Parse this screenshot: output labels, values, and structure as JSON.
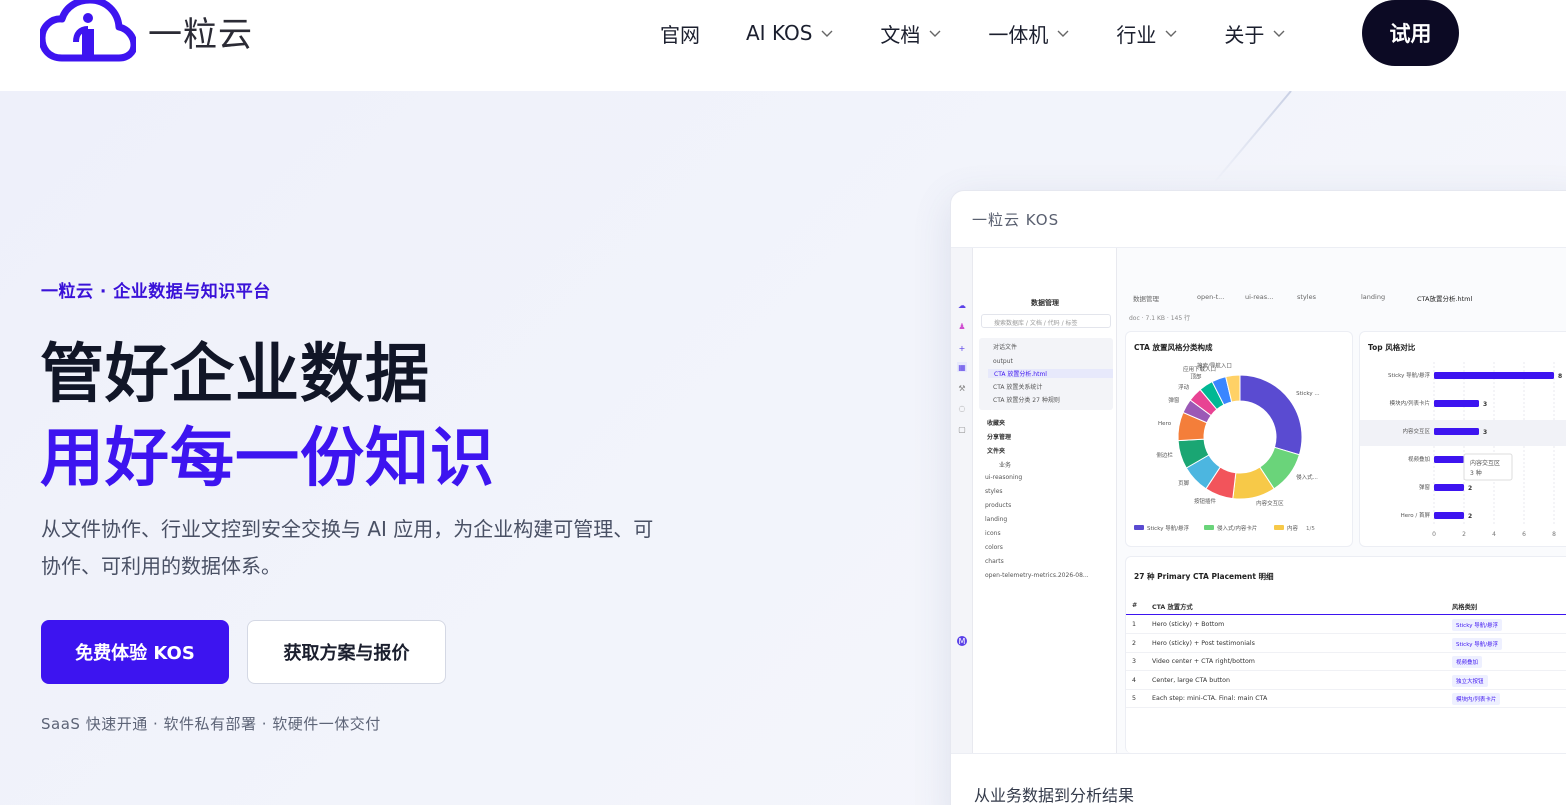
{
  "brand": {
    "name": "一粒云",
    "accent": "#3d14f0",
    "dark": "#0c0a24"
  },
  "nav": {
    "items": [
      {
        "label": "官网",
        "has_dropdown": false
      },
      {
        "label": "AI KOS",
        "has_dropdown": true
      },
      {
        "label": "文档",
        "has_dropdown": true
      },
      {
        "label": "一体机",
        "has_dropdown": true
      },
      {
        "label": "行业",
        "has_dropdown": true
      },
      {
        "label": "关于",
        "has_dropdown": true
      }
    ],
    "try_label": "试用"
  },
  "hero": {
    "eyebrow": "一粒云 · 企业数据与知识平台",
    "title_line1": "管好企业数据",
    "title_line2": "用好每一份知识",
    "description": "从文件协作、行业文控到安全交换与 AI 应用，为企业构建可管理、可协作、可利用的数据体系。",
    "cta_primary": "免费体验 KOS",
    "cta_secondary": "获取方案与报价",
    "footnote": "SaaS 快速开通 · 软件私有部署 · 软硬件一体交付"
  },
  "preview": {
    "window_title": "一粒云 KOS",
    "footer_text": "从业务数据到分析结果",
    "panel": {
      "title": "数据管理",
      "search_placeholder": "搜索数据库 / 文档 / 代码 / 标签",
      "section_label": "对话文件",
      "items": [
        "output",
        "CTA 放置分析.html",
        "CTA 放置关系统计",
        "CTA 放置分类 27 种规则"
      ],
      "groups": [
        "收藏夹",
        "分享管理",
        "文件夹"
      ],
      "folder_items": [
        "业务",
        "ui-reasoning",
        "styles",
        "products",
        "landing",
        "icons",
        "colors",
        "charts",
        "open-telemetry-metrics.2026-08..."
      ]
    },
    "tabs": [
      "数据管理",
      "open-t...",
      "ui-reas...",
      "styles",
      "landing",
      "CTA放置分析.html"
    ],
    "info": "doc · 7.1 KB · 145 行",
    "donut": {
      "title": "CTA 放置风格分类构成",
      "slices": [
        {
          "label": "Sticky ...",
          "value": 8,
          "color": "#5a4bd1"
        },
        {
          "label": "侵入式...",
          "value": 3,
          "color": "#6ad47a"
        },
        {
          "label": "内容交互区",
          "value": 3,
          "color": "#f7c948"
        },
        {
          "label": "按钮插件",
          "value": 2,
          "color": "#f2545b"
        },
        {
          "label": "页脚",
          "value": 2,
          "color": "#4cb6e0"
        },
        {
          "label": "侧边栏",
          "value": 2,
          "color": "#1aa673"
        },
        {
          "label": "Hero",
          "value": 2,
          "color": "#f47e3a"
        },
        {
          "label": "弹窗",
          "value": 1,
          "color": "#9b59b6"
        },
        {
          "label": "浮动",
          "value": 1,
          "color": "#e84393"
        },
        {
          "label": "顶部",
          "value": 1,
          "color": "#00b894"
        },
        {
          "label": "应用下载入口",
          "value": 1,
          "color": "#3a86ff"
        },
        {
          "label": "搜索/导航入口",
          "value": 1,
          "color": "#ffd166"
        }
      ],
      "legend": [
        "Sticky 导航/悬浮",
        "侵入式/内容卡片",
        "内容"
      ],
      "pager": "1/5"
    },
    "bars": {
      "title": "Top 风格对比",
      "categories": [
        "Sticky 导航/悬浮",
        "模块内/列表卡片",
        "内容交互区",
        "视频叠加",
        "弹窗",
        "Hero / 首屏"
      ],
      "values": [
        8,
        3,
        3,
        2,
        2,
        2
      ],
      "ticks": [
        "0",
        "2",
        "4",
        "6",
        "8"
      ],
      "tooltip_title": "内容交互区",
      "tooltip_value": "3 种"
    },
    "table": {
      "title": "27 种 Primary CTA Placement 明细",
      "headers": [
        "#",
        "CTA 放置方式",
        "风格类别"
      ],
      "rows": [
        [
          "1",
          "Hero (sticky) + Bottom",
          "Sticky 导航/悬浮"
        ],
        [
          "2",
          "Hero (sticky) + Post testimonials",
          "Sticky 导航/悬浮"
        ],
        [
          "3",
          "Video center + CTA right/bottom",
          "视频叠加"
        ],
        [
          "4",
          "Center, large CTA button",
          "独立大按钮"
        ],
        [
          "5",
          "Each step: mini-CTA. Final: main CTA",
          "模块内/列表卡片"
        ]
      ]
    }
  }
}
